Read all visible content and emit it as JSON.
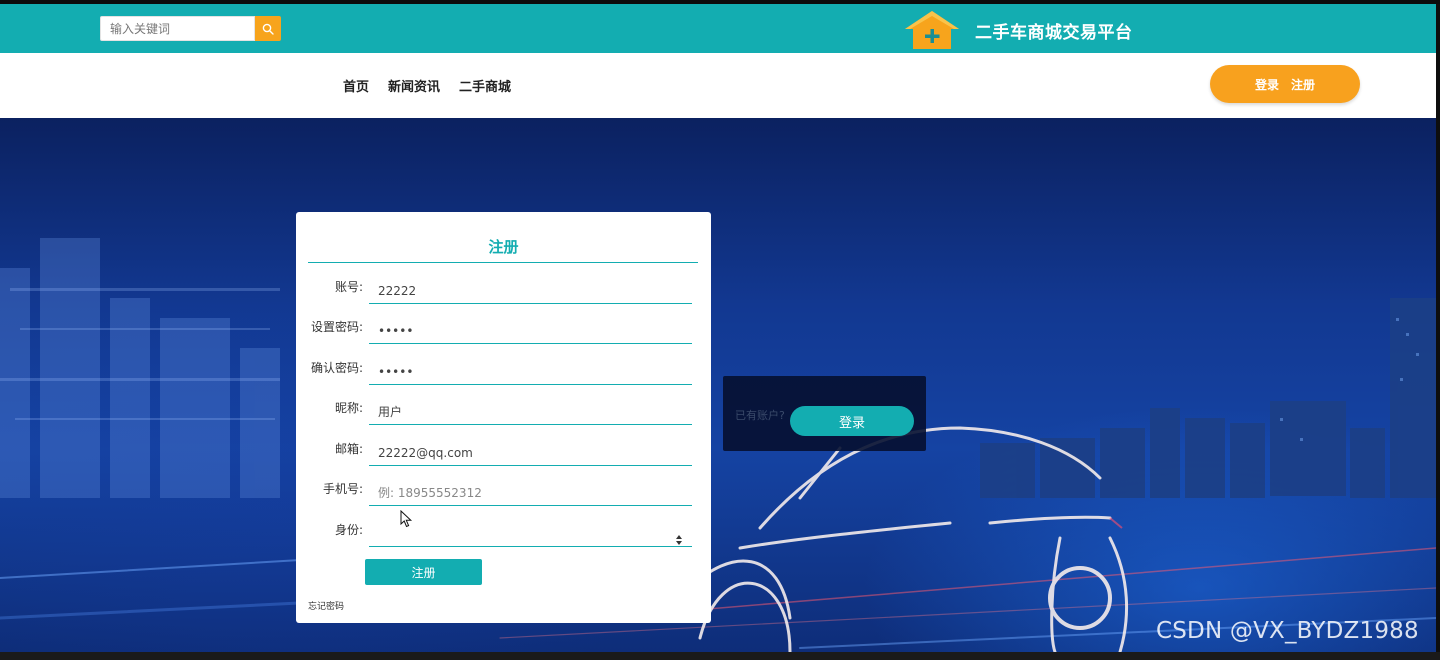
{
  "header": {
    "search_placeholder": "输入关键词",
    "brand_title": "二手车商城交易平台"
  },
  "nav": {
    "links": [
      "首页",
      "新闻资讯",
      "二手商城"
    ],
    "login_label": "登录",
    "register_label": "注册"
  },
  "login_card": {
    "text": "已有账户?",
    "button_label": "登录"
  },
  "register_form": {
    "title": "注册",
    "fields": [
      {
        "label": "账号:",
        "value": "22222",
        "placeholder": ""
      },
      {
        "label": "设置密码:",
        "value": "•••••",
        "placeholder": ""
      },
      {
        "label": "确认密码:",
        "value": "•••••",
        "placeholder": ""
      },
      {
        "label": "昵称:",
        "value": "用户",
        "placeholder": ""
      },
      {
        "label": "邮箱:",
        "value": "22222@qq.com",
        "placeholder": ""
      },
      {
        "label": "手机号:",
        "value": "",
        "placeholder": "例: 18955552312"
      }
    ],
    "role_label": "身份:",
    "role_value": "",
    "submit_label": "注册",
    "forgot_label": "忘记密码"
  },
  "watermark": "CSDN @VX_BYDZ1988",
  "colors": {
    "teal": "#13adb1",
    "orange": "#f8a11e"
  }
}
